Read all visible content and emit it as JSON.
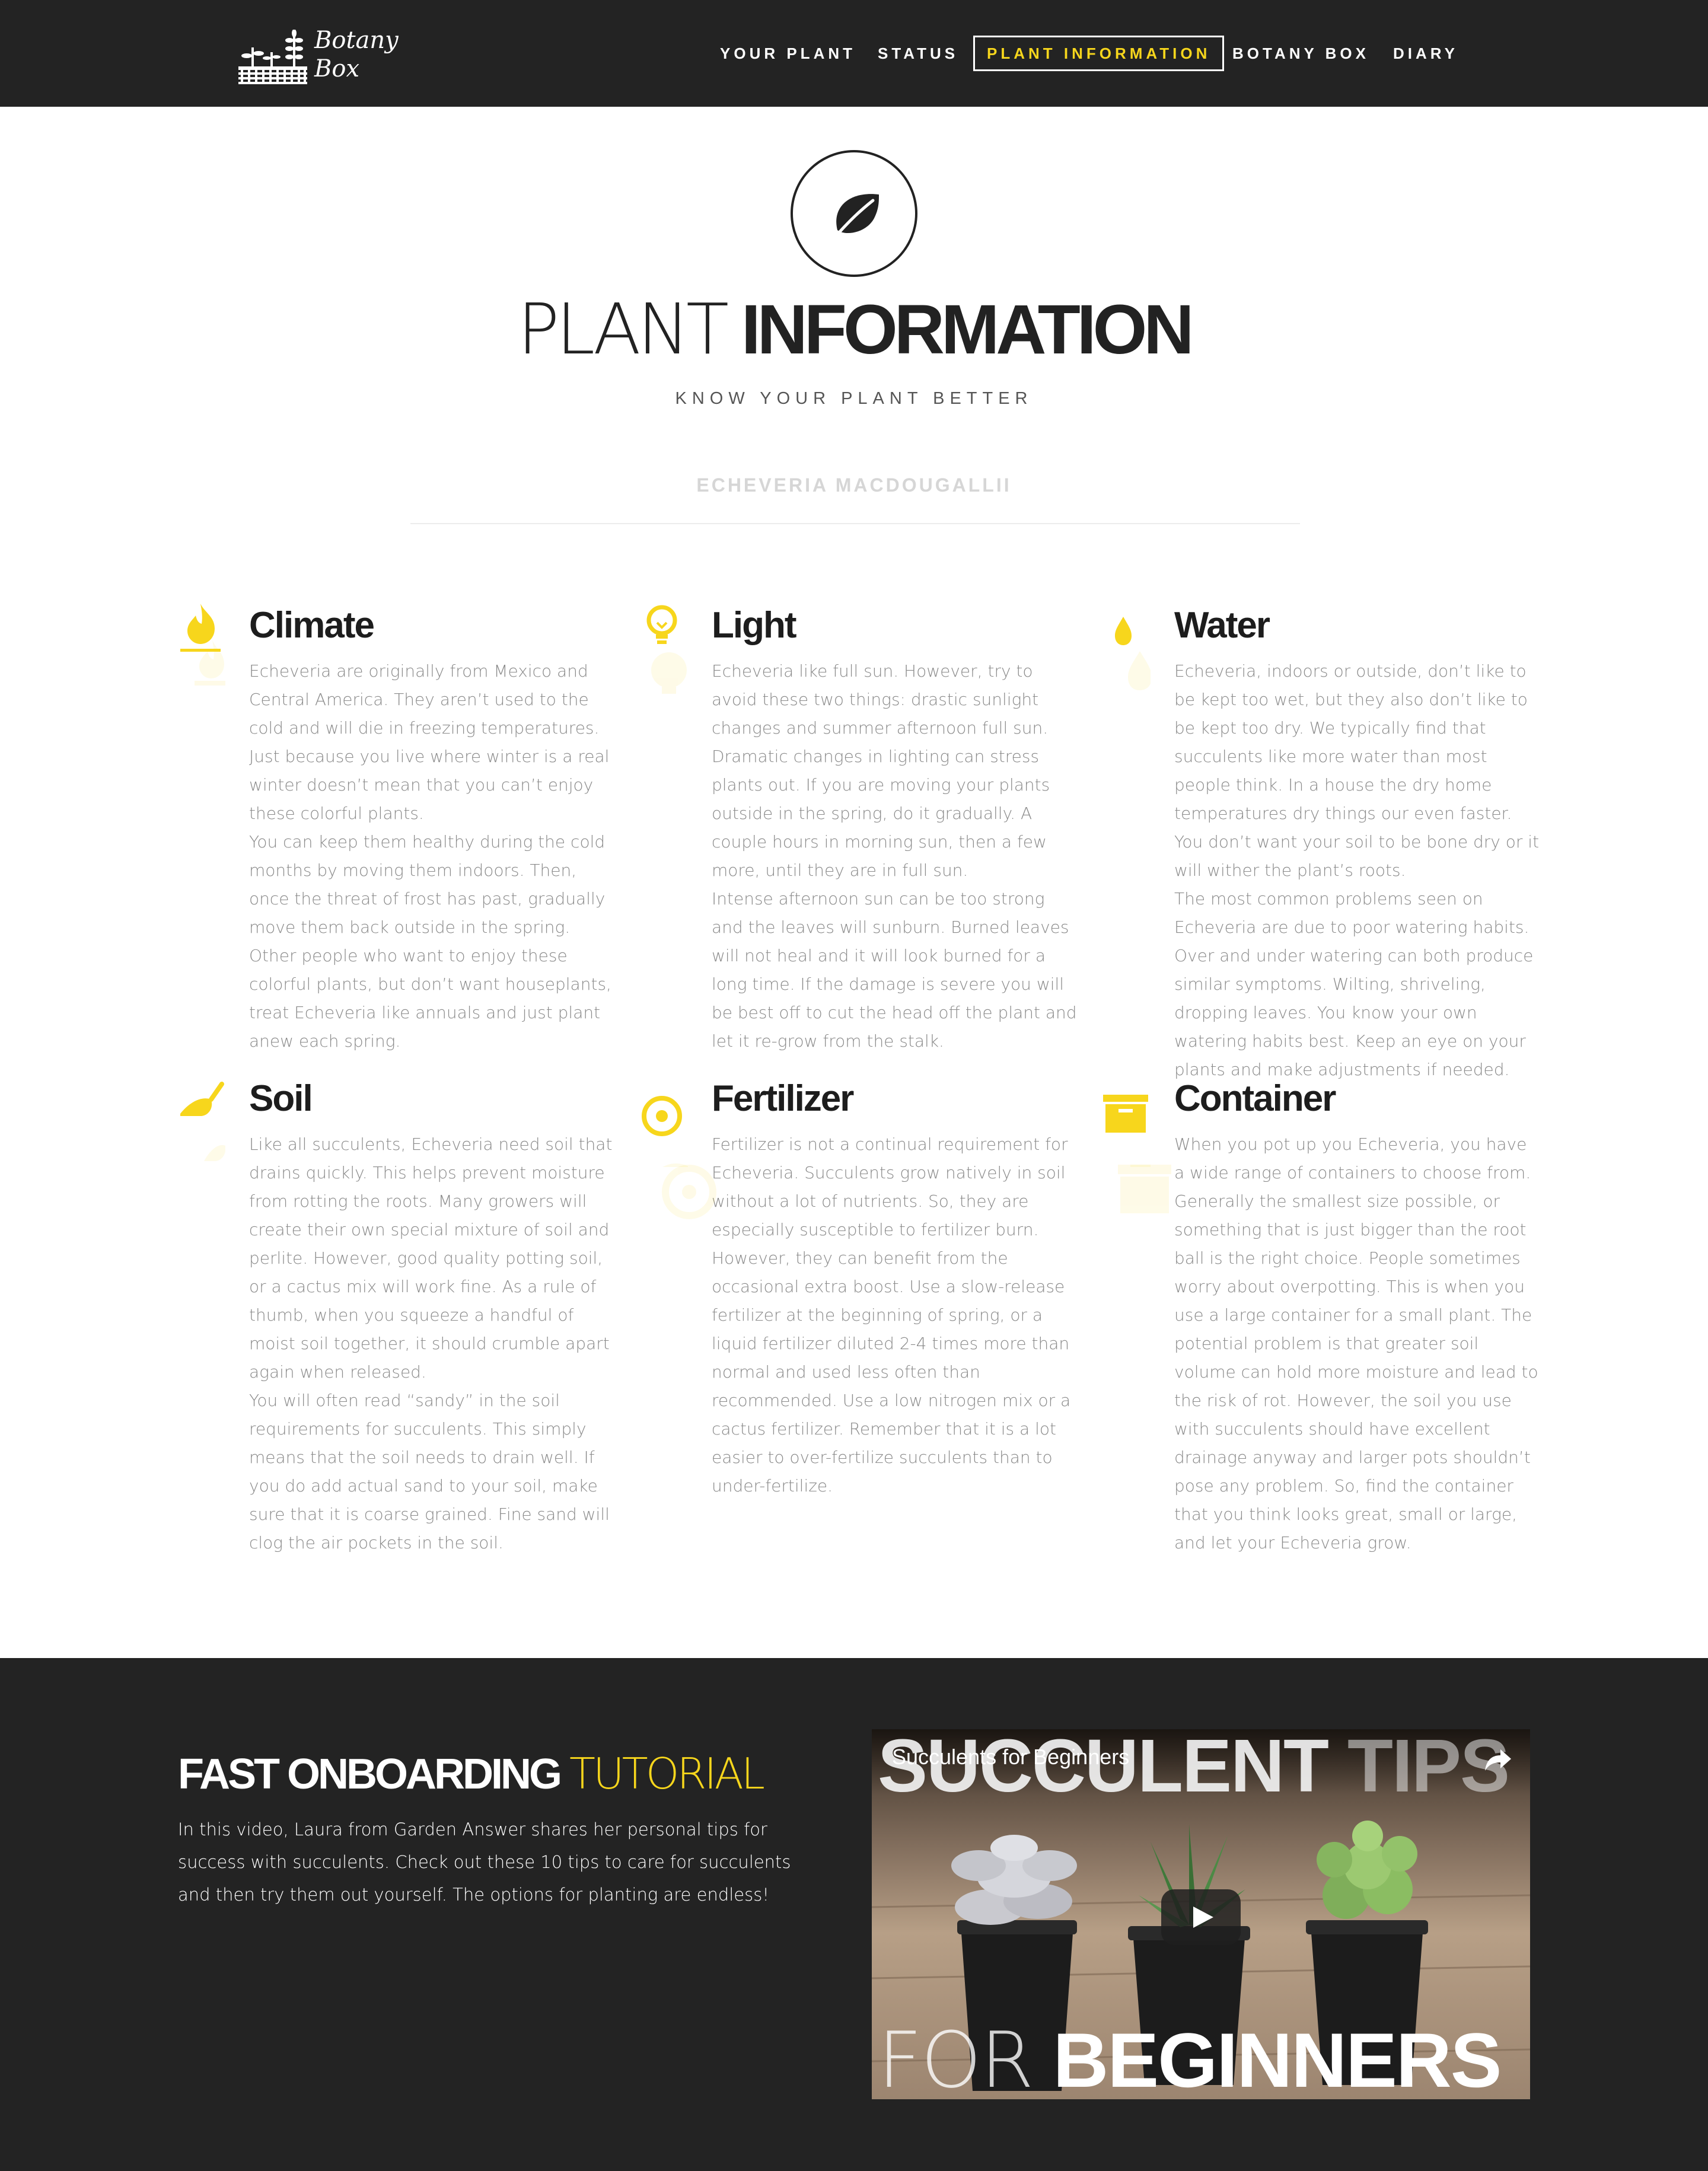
{
  "nav": {
    "logo_line1": "Botany",
    "logo_line2": "Box",
    "items": [
      {
        "label": "YOUR PLANT"
      },
      {
        "label": "STATUS"
      },
      {
        "label": "PLANT INFORMATION"
      },
      {
        "label": "BOTANY BOX"
      },
      {
        "label": "DIARY"
      }
    ],
    "active_index": 2
  },
  "hero": {
    "icon": "leaf-icon",
    "title_light": "PLANT",
    "title_bold": "INFORMATION",
    "subtitle": "KNOW YOUR PLANT BETTER",
    "plant_name": "ECHEVERIA MACDOUGALLII"
  },
  "info": [
    {
      "icon": "flame-icon",
      "title": "Climate",
      "paragraphs": [
        "Echeveria are originally from Mexico and Central America. They aren’t used to the cold and will die in freezing temperatures. Just because you live where winter is a real winter doesn’t mean that you can’t enjoy these colorful plants.",
        "You can keep them healthy during the cold months by moving them indoors. Then, once the threat of frost has past, gradually move them back outside in the spring. Other people who want to enjoy these colorful plants, but don’t want houseplants, treat Echeveria like annuals and just plant anew each spring."
      ]
    },
    {
      "icon": "lightbulb-icon",
      "title": "Light",
      "paragraphs": [
        "Echeveria like full sun. However, try to avoid these two things: drastic sunlight changes and summer afternoon full sun.",
        "Dramatic changes in lighting can stress plants out. If you are moving your plants outside in the spring, do it gradually. A couple hours in morning sun, then a few more, until they are in full sun.",
        "Intense afternoon sun can be too strong and the leaves will sunburn. Burned leaves will not heal and it will look burned for a long time. If the damage is severe you will be best off to cut the head off the plant and let it re-grow from the stalk."
      ]
    },
    {
      "icon": "water-drop-icon",
      "title": "Water",
      "paragraphs": [
        "Echeveria, indoors or outside, don’t like to be kept too wet, but they also don’t like to be kept too dry. We typically find that succulents like more water than most people think. In a house the dry home temperatures dry things our even faster. You don’t want your soil to be bone dry or it will wither the plant’s roots.",
        "The most common problems seen on Echeveria are due to poor watering habits. Over and under watering can both produce similar symptoms. Wilting, shriveling, dropping leaves. You know your own watering habits best. Keep an eye on your plants and make adjustments if needed."
      ]
    },
    {
      "icon": "trowel-icon",
      "title": "Soil",
      "paragraphs": [
        "Like all succulents, Echeveria need soil that drains quickly. This helps prevent moisture from rotting the roots. Many growers will create their own special mixture of soil and perlite. However, good quality potting soil, or a cactus mix will work fine. As a rule of thumb, when you squeeze a handful of moist soil together, it should crumble apart again when released.",
        "You will often read “sandy” in the soil requirements for succulents. This simply means that the soil needs to drain well. If you do add actual sand to your soil, make sure that it is coarse grained. Fine sand will clog the air pockets in the soil."
      ]
    },
    {
      "icon": "target-icon",
      "title": "Fertilizer",
      "paragraphs": [
        "Fertilizer is not a continual requirement for Echeveria. Succulents grow natively in soil without a lot of nutrients. So, they are especially susceptible to fertilizer burn. However, they can benefit from the occasional extra boost. Use a slow-release fertilizer at the beginning of spring, or a liquid fertilizer diluted 2-4 times more than normal and used less often than recommended. Use a low nitrogen mix or a cactus fertilizer. Remember that it is a lot easier to over-fertilize succulents than to under-fertilize."
      ]
    },
    {
      "icon": "box-icon",
      "title": "Container",
      "paragraphs": [
        "When you pot up you Echeveria, you have a wide range of containers to choose from. Generally the smallest size possible, or something that is just bigger than the root ball is the right choice. People sometimes worry about overpotting. This is when you use a large container for a small plant. The potential problem is that greater soil volume can hold more moisture and lead to the risk of rot. However, the soil you use with succulents should have excellent drainage anyway and larger pots shouldn’t pose any problem. So, find the container that you think looks great, small or large, and let your Echeveria grow."
      ]
    }
  ],
  "tutorial": {
    "title_bold": "FAST ONBOARDING",
    "title_light": "TUTORIAL",
    "text": "In this video, Laura from Garden Answer shares her personal tips for success with succulents. Check out these 10 tips to care for succulents and then try them out yourself. The options for planting are endless!",
    "video": {
      "title": "Succulents for Beginners",
      "overlay_top_bold": "SUCCULENT",
      "overlay_top_dim": "TIPS",
      "overlay_bottom_light": "FOR",
      "overlay_bottom_bold": "BEGINNERS"
    }
  },
  "colors": {
    "accent": "#f7d61c",
    "dark": "#232323"
  }
}
